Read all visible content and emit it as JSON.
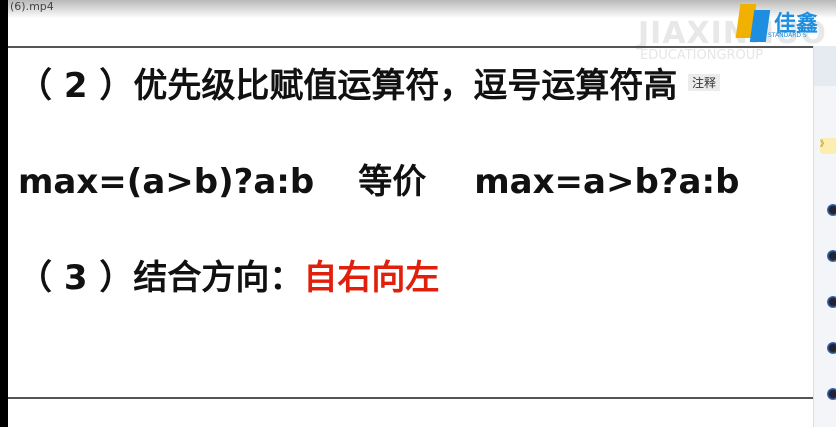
{
  "window": {
    "filename": "(6).mp4"
  },
  "logo": {
    "brand": "佳鑫",
    "sub": "STANDARD S",
    "watermark": "JIAXINNUO",
    "watermark2": "EDUCATIONGROUP"
  },
  "slide": {
    "line1": "（ 2 ）优先级比赋值运算符，逗号运算符高",
    "line2a": "max=(a>b)?a:b",
    "line2b": "等价",
    "line2c": "max=a>b?a:b",
    "line3a": "（ 3 ）结合方向：",
    "line3b": "自右向左"
  },
  "tooltip": "注释",
  "panel": {
    "tag": "》"
  },
  "colors": {
    "accent": "#e0200c",
    "brand": "#1e8fe0"
  }
}
